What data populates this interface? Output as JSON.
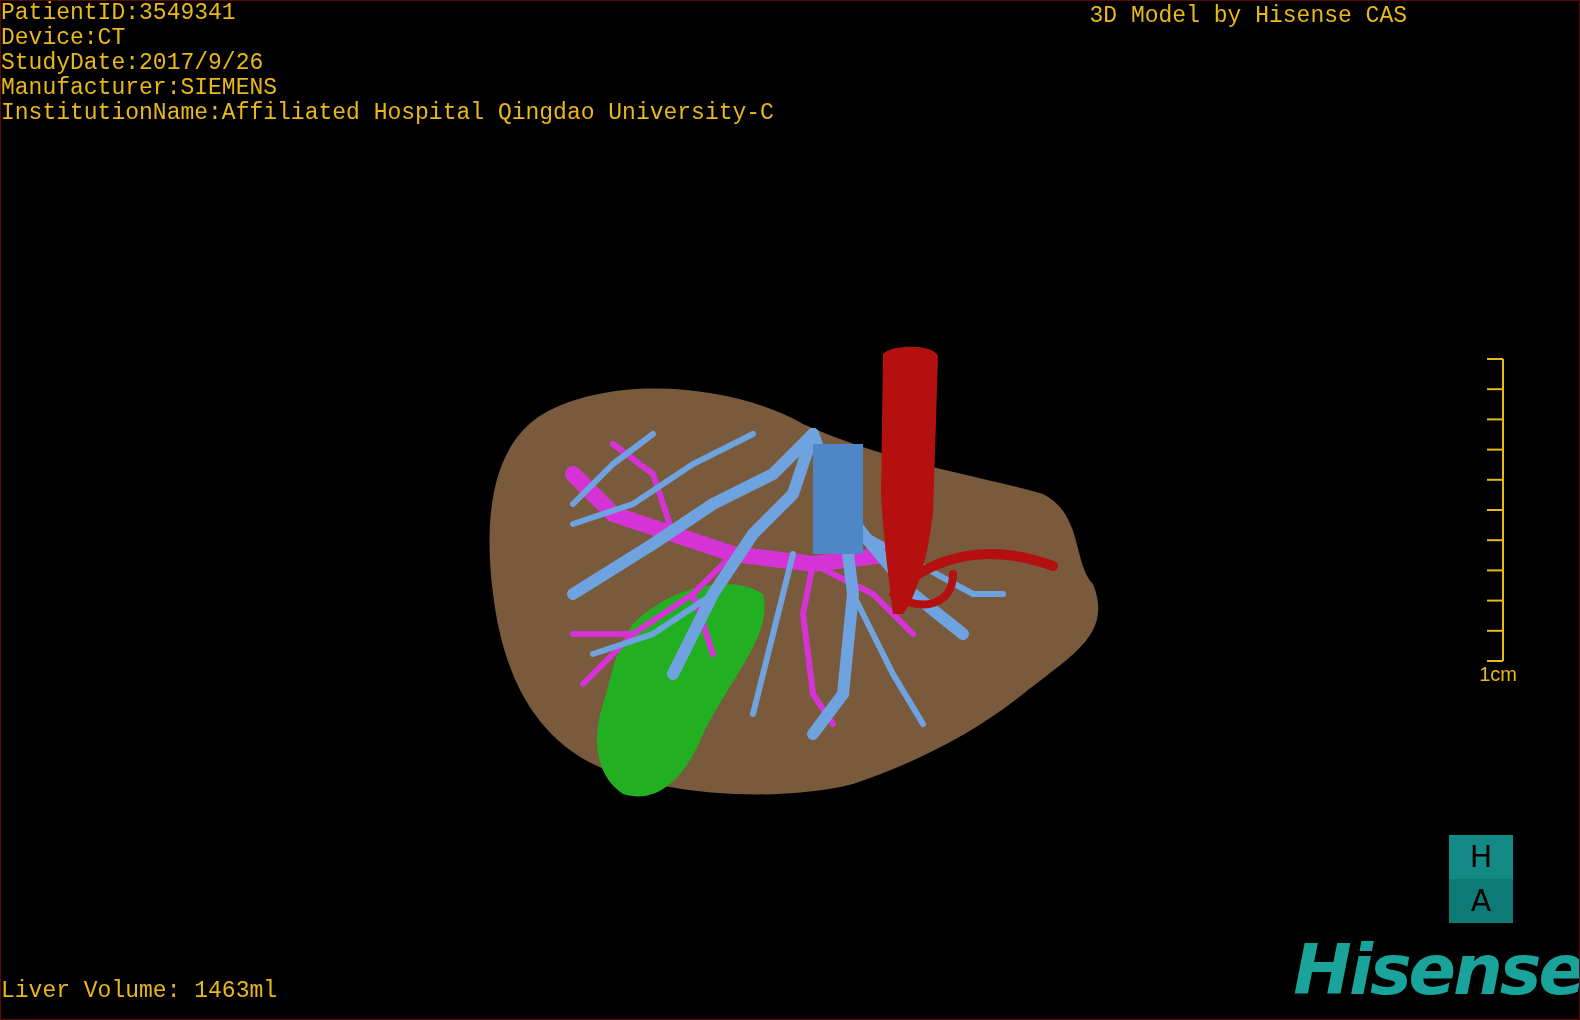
{
  "info_lines": [
    "PatientID:3549341",
    "Device:CT",
    "StudyDate:2017/9/26",
    "Manufacturer:SIEMENS",
    "InstitutionName:Affiliated Hospital Qingdao University-C"
  ],
  "header": "3D Model by Hisense CAS",
  "scale_bar": {
    "label": "1cm"
  },
  "liver_volume": "Liver Volume: 1463ml",
  "logo": {
    "badge_letters": [
      "H",
      "A"
    ],
    "wordmark": "Hisense"
  }
}
